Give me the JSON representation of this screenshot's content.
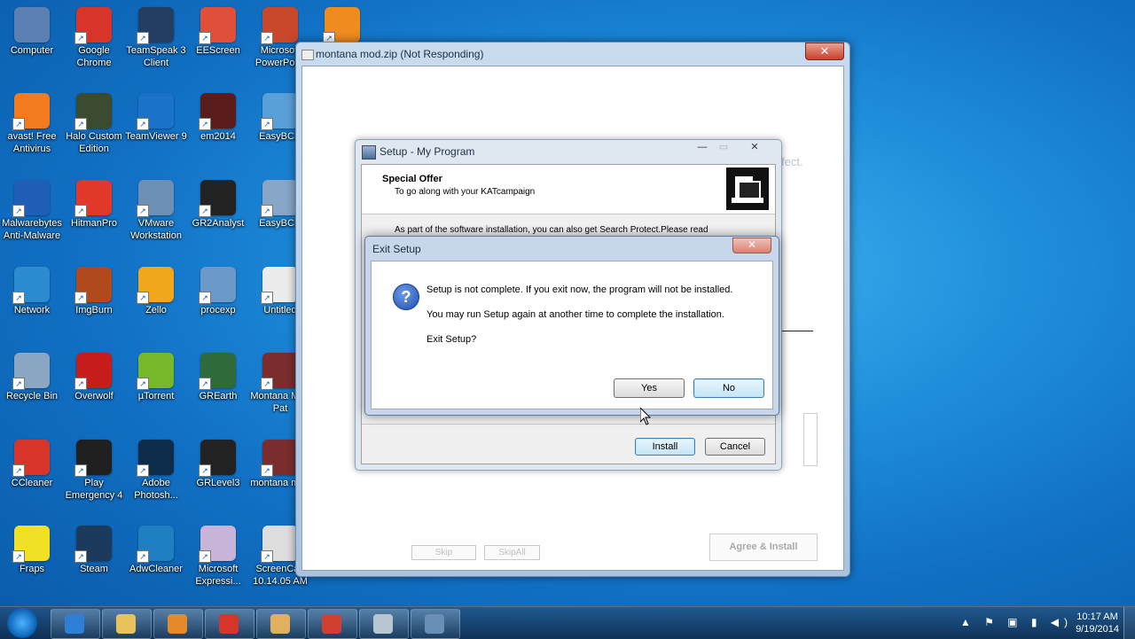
{
  "desktop_icons": [
    {
      "label": "Computer",
      "color": "#5a7fb0"
    },
    {
      "label": "Google Chrome",
      "color": "#d8352a"
    },
    {
      "label": "TeamSpeak 3 Client",
      "color": "#243e63"
    },
    {
      "label": "EEScreen",
      "color": "#e04f3a"
    },
    {
      "label": "Microsoft PowerPoint",
      "color": "#c9472b"
    },
    {
      "label": "",
      "color": "#f08b1d"
    },
    {
      "label": "avast! Free Antivirus",
      "color": "#f47a20"
    },
    {
      "label": "Halo Custom Edition",
      "color": "#3a4b30"
    },
    {
      "label": "TeamViewer 9",
      "color": "#1b73c9"
    },
    {
      "label": "em2014",
      "color": "#5b1c1c"
    },
    {
      "label": "EasyBCD",
      "color": "#5aa0d8"
    },
    {
      "label": "Malwarebytes Anti-Malware",
      "color": "#1f5fb8"
    },
    {
      "label": "HitmanPro",
      "color": "#e2382a"
    },
    {
      "label": "VMware Workstation",
      "color": "#6d8fb6"
    },
    {
      "label": "GR2Analyst",
      "color": "#222"
    },
    {
      "label": "EasyBCD",
      "color": "#87a6c8"
    },
    {
      "label": "Network",
      "color": "#2d8bd2"
    },
    {
      "label": "ImgBurn",
      "color": "#b04a1c"
    },
    {
      "label": "Zello",
      "color": "#f0a81a"
    },
    {
      "label": "procexp",
      "color": "#6b9ac9"
    },
    {
      "label": "Untitled",
      "color": "#ececec"
    },
    {
      "label": "Recycle Bin",
      "color": "#8aa6c2"
    },
    {
      "label": "Overwolf",
      "color": "#c71c1c"
    },
    {
      "label": "µTorrent",
      "color": "#76b82a"
    },
    {
      "label": "GREarth",
      "color": "#2f6a3a"
    },
    {
      "label": "Montana Mod Pat",
      "color": "#7b2d2d"
    },
    {
      "label": "CCleaner",
      "color": "#d8352a"
    },
    {
      "label": "Play Emergency 4",
      "color": "#202020"
    },
    {
      "label": "Adobe Photosh...",
      "color": "#0d2c4a"
    },
    {
      "label": "GRLevel3",
      "color": "#222"
    },
    {
      "label": "montana mod",
      "color": "#7b2d2d"
    },
    {
      "label": "Fraps",
      "color": "#f2e024"
    },
    {
      "label": "Steam",
      "color": "#1b3a5c"
    },
    {
      "label": "AdwCleaner",
      "color": "#1f7fc1"
    },
    {
      "label": "Microsoft Expressi...",
      "color": "#c8b4d8"
    },
    {
      "label": "ScreenCap 10.14.05 AM",
      "color": "#ddd"
    }
  ],
  "bg_window": {
    "title": "montana mod.zip (Not Responding)",
    "close": "✕",
    "partial_text": "fect.",
    "skip": "Skip",
    "skip_all": "SkipAll",
    "agree_install": "Agree & Install"
  },
  "setup_window": {
    "title": "Setup - My Program",
    "heading": "Special Offer",
    "subheading": "To go along with your KATcampaign",
    "info": "As part of the software installation, you can also get Search Protect.Please read",
    "install": "Install",
    "cancel": "Cancel",
    "min": "—",
    "max": "▭",
    "close": "✕"
  },
  "exit_dialog": {
    "title": "Exit Setup",
    "close": "✕",
    "icon": "?",
    "line1": "Setup is not complete. If you exit now, the program will not be installed.",
    "line2": "You may run Setup again at another time to complete the installation.",
    "line3": "Exit Setup?",
    "yes": "Yes",
    "no": "No"
  },
  "taskbar": {
    "items": [
      {
        "name": "internet-explorer",
        "color": "#2f7fd6"
      },
      {
        "name": "file-explorer",
        "color": "#e8c25a"
      },
      {
        "name": "media-player",
        "color": "#e58a2a"
      },
      {
        "name": "chrome",
        "color": "#d8352a"
      },
      {
        "name": "paint",
        "color": "#e0b060"
      },
      {
        "name": "eescreen",
        "color": "#d04030"
      },
      {
        "name": "window-app",
        "color": "#b8c6d2"
      },
      {
        "name": "setup-app",
        "color": "#6a8fb6"
      }
    ],
    "tray_icons": "▲ ⚑ ▣ ▮ ◀)",
    "time": "10:17 AM",
    "date": "9/19/2014"
  }
}
